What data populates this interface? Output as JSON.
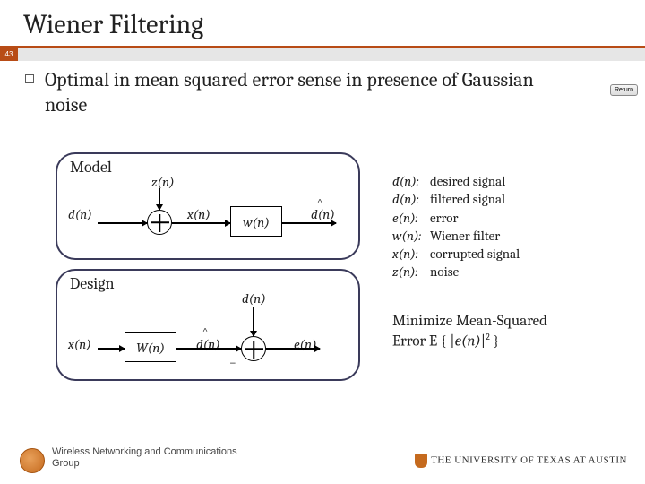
{
  "page_number": "43",
  "title": "Wiener Filtering",
  "main_bullet": "Optimal in mean squared error sense in presence of Gaussian noise",
  "return_label": "Return",
  "model": {
    "title": "Model",
    "z": "z(n)",
    "d": "d(n)",
    "x": "x(n)",
    "w": "w(n)",
    "dhat": "d(n)"
  },
  "design": {
    "title": "Design",
    "x": "x(n)",
    "filter": "W(n)",
    "dhat": "d(n)",
    "d": "d(n)",
    "e": "e(n)",
    "minus": "−"
  },
  "legend": {
    "items": [
      {
        "sym": "d̂(n):",
        "desc": "desired signal"
      },
      {
        "sym": "d(n):",
        "desc": "filtered signal"
      },
      {
        "sym": "e(n):",
        "desc": "error"
      },
      {
        "sym": "w(n):",
        "desc": "Wiener filter"
      },
      {
        "sym": "x(n):",
        "desc": "corrupted signal"
      },
      {
        "sym": "z(n):",
        "desc": "noise"
      }
    ]
  },
  "minimize": {
    "line1": "Minimize Mean-Squared",
    "line2_a": "Error E { |",
    "line2_b": "e(n)",
    "line2_c": "|",
    "line2_exp": "2",
    "line2_d": " }"
  },
  "footer": {
    "group1": "Wireless Networking and Communications",
    "group2": "Group",
    "ut": "THE UNIVERSITY OF TEXAS AT AUSTIN"
  }
}
